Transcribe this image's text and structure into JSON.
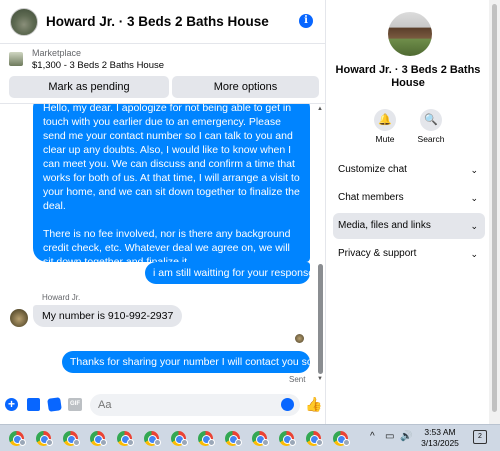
{
  "header": {
    "title": "Howard Jr. · 3 Beds 2 Baths House",
    "info_icon": "info-icon"
  },
  "marketplace": {
    "label": "Marketplace",
    "listing": "$1,300 - 3 Beds 2 Baths House",
    "mark_pending": "Mark as pending",
    "more_options": "More options"
  },
  "messages": {
    "big_message_p1": "Hello, my dear. I apologize for not being able to get in touch with you earlier due to an emergency. Please send me your contact number so I can talk to you and clear up any doubts. Also, I would like to know when I can meet you. We can discuss and confirm a time that works for both of us. At that time, I will arrange a visit to your home, and we can sit down together to finalize the deal.",
    "big_message_p2": "There is no fee involved, nor is there any background credit check, etc. Whatever deal we agree on, we will sit down together and finalize it.",
    "waiting": "i am still waitting for your response",
    "sender_name": "Howard Jr.",
    "number_reply": "My number is 910-992-2937",
    "thanks": "Thanks for sharing your number I will contact you soon",
    "status": "Sent"
  },
  "composer": {
    "placeholder": "Aa",
    "gif": "GIF"
  },
  "info_panel": {
    "name": "Howard Jr. · 3 Beds 2 Baths House",
    "mute_label": "Mute",
    "search_label": "Search",
    "sections": [
      "Customize chat",
      "Chat members",
      "Media, files and links",
      "Privacy & support"
    ]
  },
  "taskbar": {
    "time": "3:53 AM",
    "date": "3/13/2025",
    "notification_count": "2",
    "app_count": 13
  },
  "colors": {
    "accent": "#0866ff",
    "bubble_out": "#0084ff",
    "bubble_in": "#e4e6eb"
  }
}
